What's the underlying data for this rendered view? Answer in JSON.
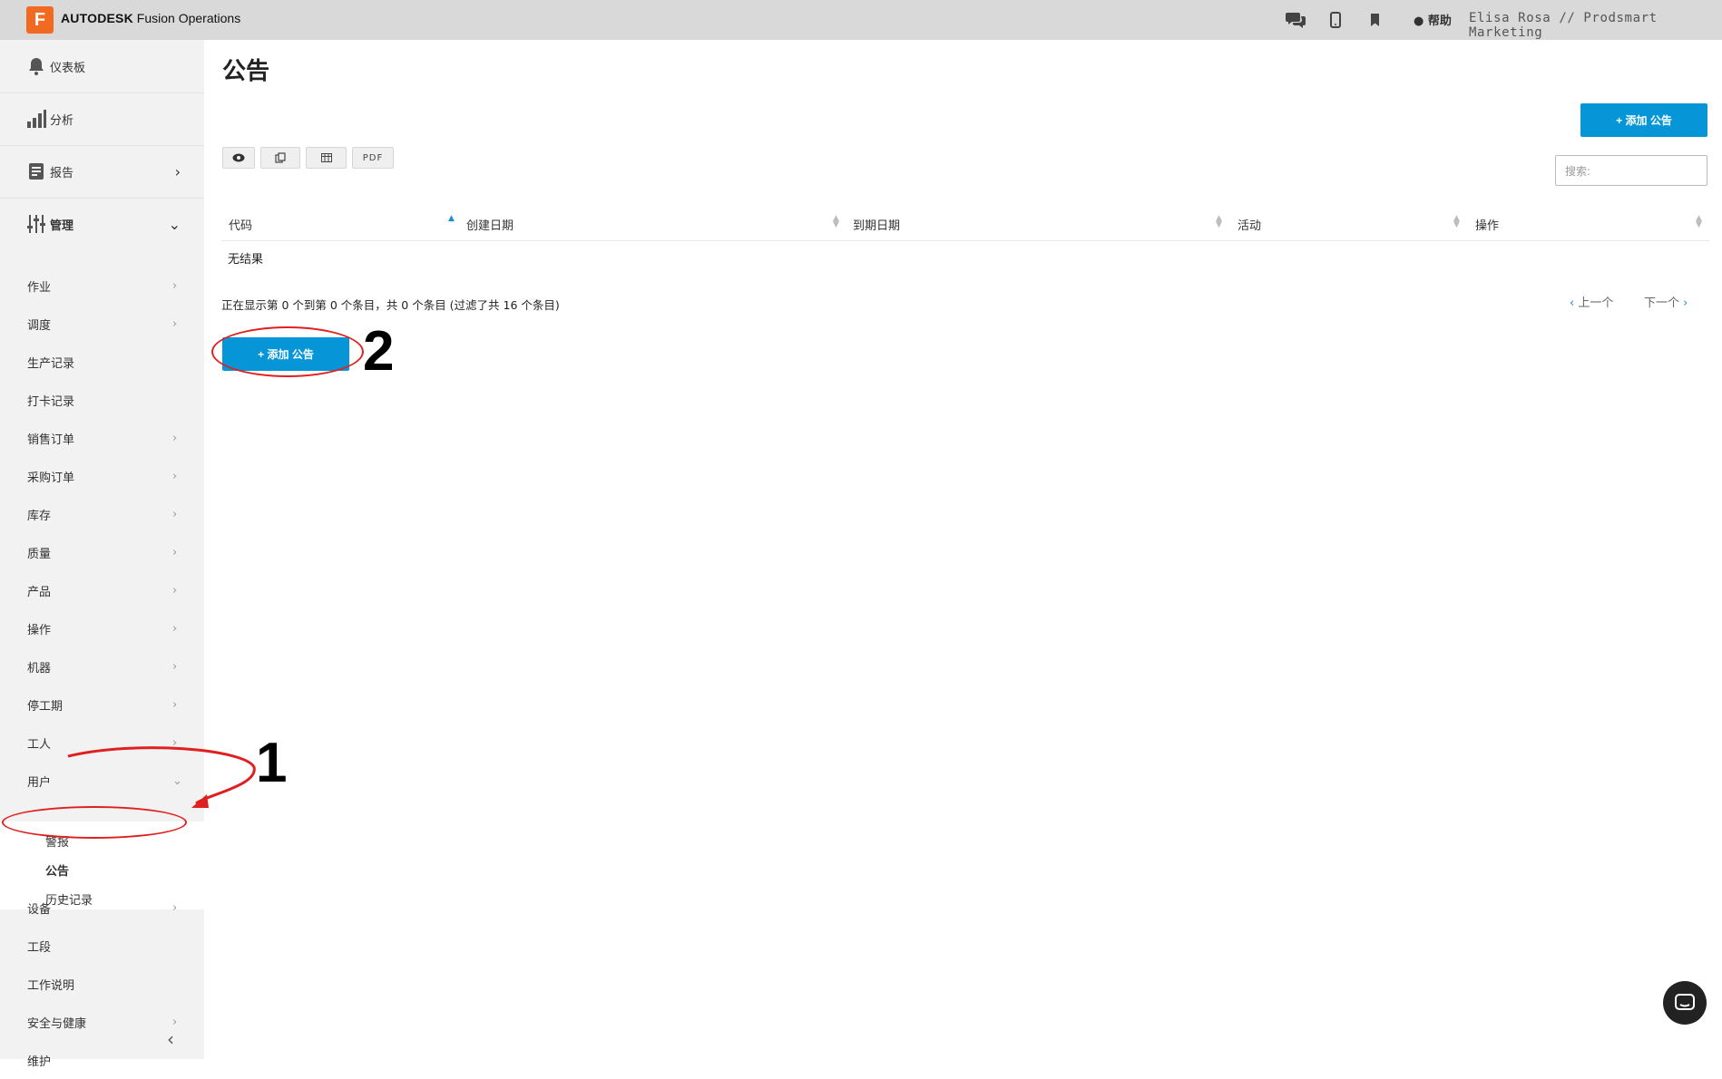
{
  "header": {
    "logo_letter": "F",
    "brand_bold": "AUTODESK",
    "brand_rest": " Fusion Operations",
    "help_label": "帮助",
    "user_label": "Elisa Rosa // Prodsmart Marketing",
    "icons": [
      "chat-bubbles-icon",
      "mobile-icon",
      "bookmark-icon",
      "help-circle-icon"
    ]
  },
  "sidebar": {
    "top_items": [
      {
        "label": "仪表板",
        "icon": "bell-icon"
      },
      {
        "label": "分析",
        "icon": "bar-chart-icon"
      },
      {
        "label": "报告",
        "icon": "report-icon",
        "chevron": "›"
      },
      {
        "label": "管理",
        "icon": "sliders-icon",
        "chevron": "⌄"
      }
    ],
    "items": [
      {
        "label": "作业",
        "chevron": "›"
      },
      {
        "label": "调度",
        "chevron": "›"
      },
      {
        "label": "生产记录",
        "chevron": ""
      },
      {
        "label": "打卡记录",
        "chevron": ""
      },
      {
        "label": "销售订单",
        "chevron": "›"
      },
      {
        "label": "采购订单",
        "chevron": "›"
      },
      {
        "label": "库存",
        "chevron": "›"
      },
      {
        "label": "质量",
        "chevron": "›"
      },
      {
        "label": "产品",
        "chevron": "›"
      },
      {
        "label": "操作",
        "chevron": "›"
      },
      {
        "label": "机器",
        "chevron": "›"
      },
      {
        "label": "停工期",
        "chevron": "›"
      },
      {
        "label": "工人",
        "chevron": "›"
      },
      {
        "label": "用户",
        "chevron": "⌄"
      }
    ],
    "sub_items": [
      "警报",
      "公告",
      "历史记录"
    ],
    "bottom_items": [
      {
        "label": "设备",
        "chevron": "›"
      },
      {
        "label": "工段",
        "chevron": ""
      },
      {
        "label": "工作说明",
        "chevron": ""
      },
      {
        "label": "安全与健康",
        "chevron": "›"
      },
      {
        "label": "维护",
        "chevron": ""
      }
    ],
    "collapse_glyph": "‹"
  },
  "main": {
    "title": "公告",
    "add_button_label": "+ 添加 公告",
    "add_button_bottom_label": "+ 添加 公告",
    "toolbar": {
      "pdf_label": "PDF"
    },
    "search_placeholder": "搜索:",
    "columns": [
      "代码",
      "创建日期",
      "到期日期",
      "活动",
      "操作"
    ],
    "empty_text": "无结果",
    "info_text": "正在显示第 0 个到第 0 个条目，共 0 个条目 (过滤了共 16 个条目)",
    "prev_label": "上一个",
    "next_label": "下一个"
  },
  "annotations": {
    "step1": "1",
    "step2": "2"
  },
  "colors": {
    "accent": "#0696d7",
    "logo": "#f26a21",
    "annotation": "#e02020"
  }
}
